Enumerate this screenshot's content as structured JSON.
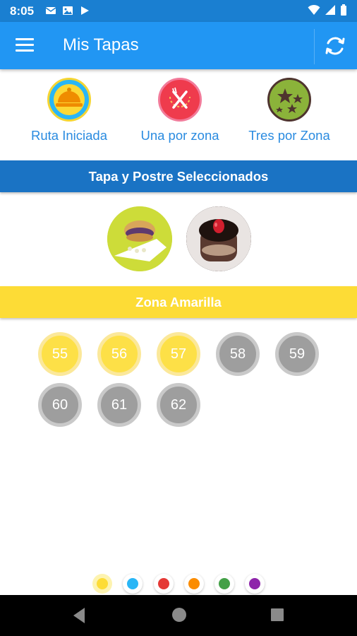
{
  "status_bar": {
    "time": "8:05",
    "left_icons": [
      "mail-icon",
      "photo-icon",
      "play-store-icon"
    ],
    "right_icons": [
      "wifi-icon",
      "signal-icon",
      "battery-icon"
    ]
  },
  "app_bar": {
    "title": "Mis Tapas",
    "menu_icon": "hamburger-menu-icon",
    "action_icon": "sync-icon"
  },
  "achievements": [
    {
      "label": "Ruta Iniciada",
      "icon": "cloche-icon",
      "color": "#29b6f6"
    },
    {
      "label": "Una por zona",
      "icon": "cutlery-icon",
      "color": "#ef3b4d"
    },
    {
      "label": "Tres por Zona",
      "icon": "stars-icon",
      "color": "#8bb33a"
    }
  ],
  "selected_section": {
    "title": "Tapa y Postre Seleccionados"
  },
  "selected_items": [
    {
      "name": "tapa-photo"
    },
    {
      "name": "postre-photo"
    }
  ],
  "zone_section": {
    "title": "Zona Amarilla",
    "color": "#fddc36"
  },
  "zone_numbers": [
    {
      "number": "55",
      "visited": true
    },
    {
      "number": "56",
      "visited": true
    },
    {
      "number": "57",
      "visited": true
    },
    {
      "number": "58",
      "visited": false
    },
    {
      "number": "59",
      "visited": false
    },
    {
      "number": "60",
      "visited": false
    },
    {
      "number": "61",
      "visited": false
    },
    {
      "number": "62",
      "visited": false
    }
  ],
  "zone_dots": [
    {
      "zone": "amarilla",
      "color": "#fddc36",
      "selected": true
    },
    {
      "zone": "azul",
      "color": "#29b6f6",
      "selected": false
    },
    {
      "zone": "roja",
      "color": "#e53935",
      "selected": false
    },
    {
      "zone": "naranja",
      "color": "#fb8c00",
      "selected": false
    },
    {
      "zone": "verde",
      "color": "#43a047",
      "selected": false
    },
    {
      "zone": "morada",
      "color": "#8e24aa",
      "selected": false
    }
  ],
  "nav_bar": [
    "back-icon",
    "home-icon",
    "recents-icon"
  ]
}
